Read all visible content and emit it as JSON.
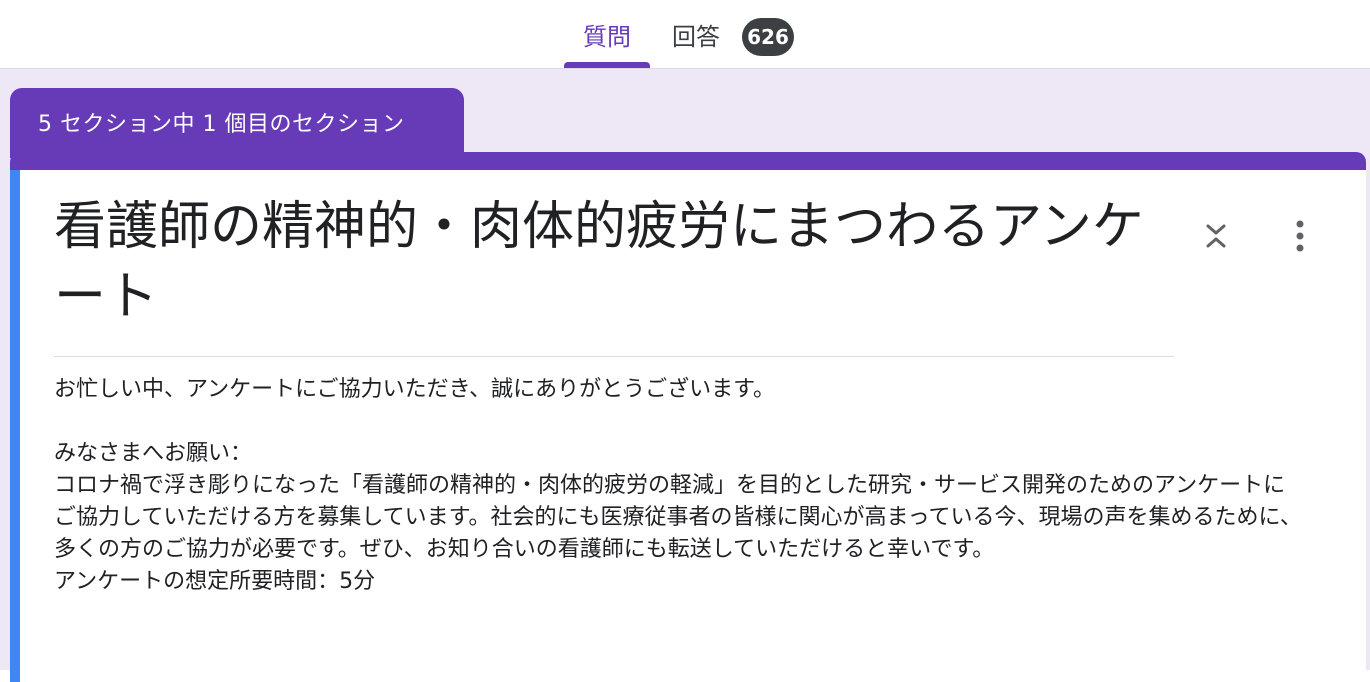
{
  "tabs": {
    "questions_label": "質問",
    "responses_label": "回答",
    "responses_count": "626"
  },
  "section": {
    "label": "5 セクション中 1 個目のセクション"
  },
  "form": {
    "title": "看護師の精神的・肉体的疲労にまつわるアンケート",
    "description": "お忙しい中、アンケートにご協力いただき、誠にありがとうございます。\n\nみなさまへお願い：\nコロナ禍で浮き彫りになった「看護師の精神的・肉体的疲労の軽減」を目的とした研究・サービス開発のためのアンケートにご協力していただける方を募集しています。社会的にも医療従事者の皆様に関心が高まっている今、現場の声を集めるために、多くの方のご協力が必要です。ぜひ、お知り合いの看護師にも転送していただけると幸いです。\nアンケートの想定所要時間：5分"
  },
  "icons": {
    "collapse": "collapse-icon",
    "more": "more-vert-icon"
  },
  "colors": {
    "accent": "#673ab7",
    "background": "#ede7f6",
    "focus_bar": "#4285f4",
    "badge": "#3c4043"
  }
}
